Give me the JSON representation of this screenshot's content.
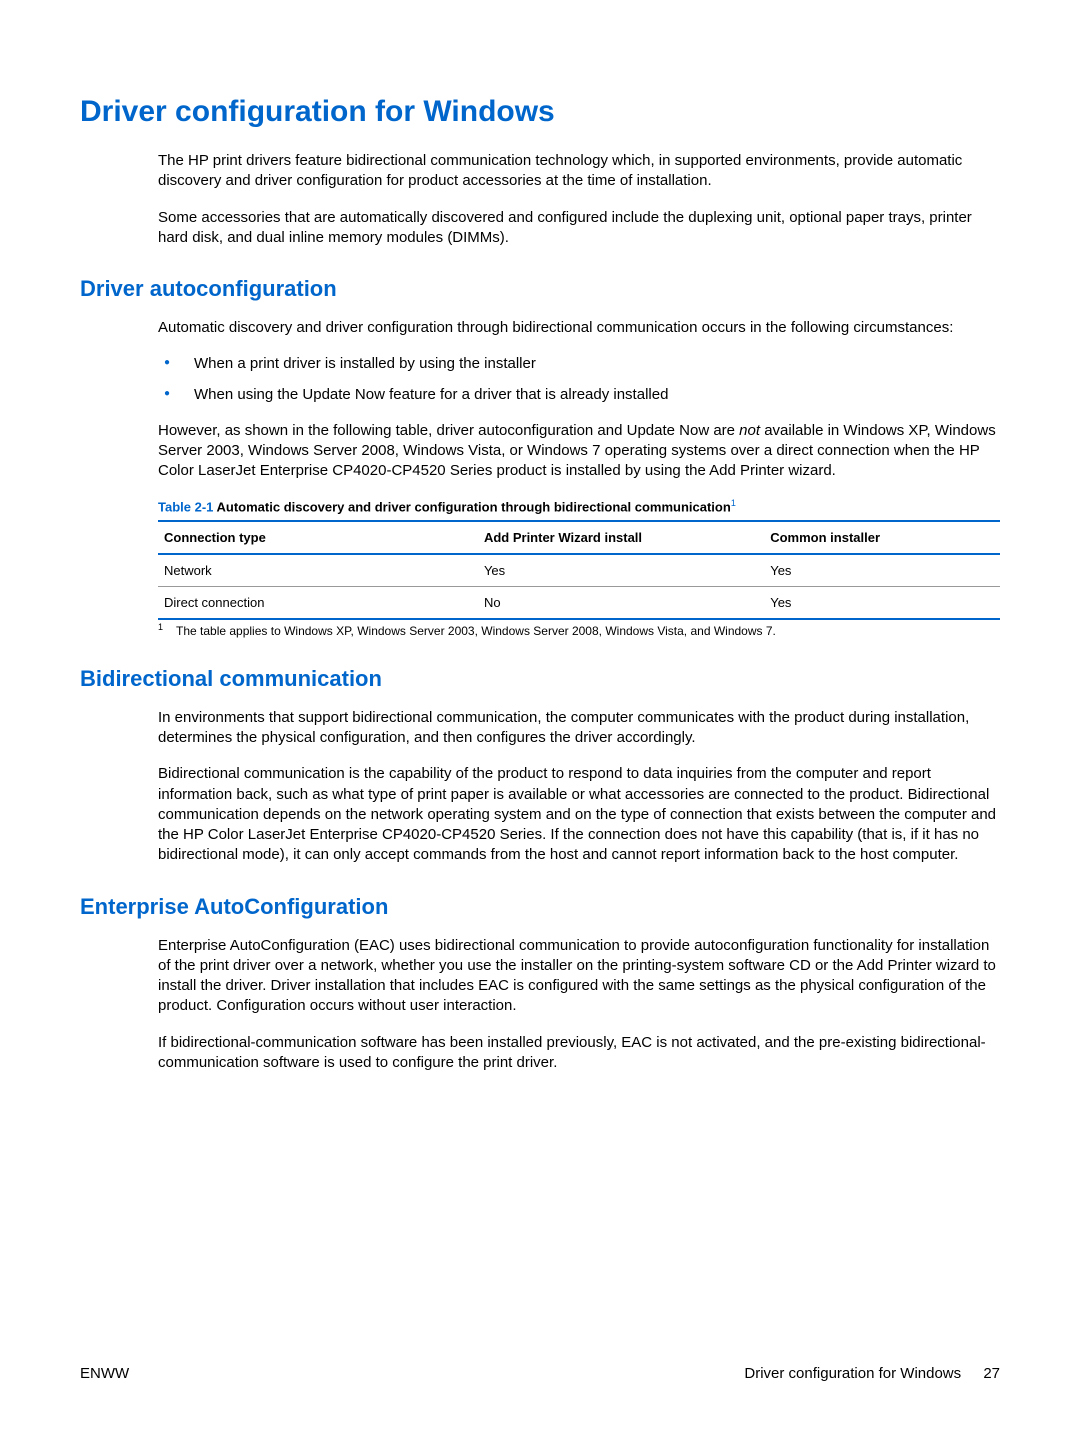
{
  "title": "Driver configuration for Windows",
  "intro": {
    "p1": "The HP print drivers feature bidirectional communication technology which, in supported environments, provide automatic discovery and driver configuration for product accessories at the time of installation.",
    "p2": "Some accessories that are automatically discovered and configured include the duplexing unit, optional paper trays, printer hard disk, and dual inline memory modules (DIMMs)."
  },
  "section_autoconfig": {
    "heading": "Driver autoconfiguration",
    "p1": "Automatic discovery and driver configuration through bidirectional communication occurs in the following circumstances:",
    "bullets": [
      "When a print driver is installed by using the installer",
      "When using the Update Now feature for a driver that is already installed"
    ],
    "p2_a": "However, as shown in the following table, driver autoconfiguration and Update Now are ",
    "p2_i": "not",
    "p2_b": " available in Windows XP, Windows Server 2003, Windows Server 2008, Windows Vista, or Windows 7 operating systems over a direct connection when the HP Color LaserJet Enterprise CP4020-CP4520 Series product is installed by using the Add Printer wizard.",
    "table": {
      "caption_label": "Table 2-1",
      "caption_title": "  Automatic discovery and driver configuration through bidirectional communication",
      "caption_sup": "1",
      "headers": [
        "Connection type",
        "Add Printer Wizard install",
        "Common installer"
      ],
      "rows": [
        [
          "Network",
          "Yes",
          "Yes"
        ],
        [
          "Direct connection",
          "No",
          "Yes"
        ]
      ]
    },
    "footnote_num": "1",
    "footnote_text": "The table applies to Windows XP, Windows Server 2003, Windows Server 2008, Windows Vista, and Windows 7."
  },
  "section_bidi": {
    "heading": "Bidirectional communication",
    "p1": "In environments that support bidirectional communication, the computer communicates with the product during installation, determines the physical configuration, and then configures the driver accordingly.",
    "p2": "Bidirectional communication is the capability of the product to respond to data inquiries from the computer and report information back, such as what type of print paper is available or what accessories are connected to the product. Bidirectional communication depends on the network operating system and on the type of connection that exists between the computer and the HP Color LaserJet Enterprise CP4020-CP4520 Series. If the connection does not have this capability (that is, if it has no bidirectional mode), it can only accept commands from the host and cannot report information back to the host computer."
  },
  "section_eac": {
    "heading": "Enterprise AutoConfiguration",
    "p1": "Enterprise AutoConfiguration (EAC) uses bidirectional communication to provide autoconfiguration functionality for installation of the print driver over a network, whether you use the installer on the printing-system software CD or the Add Printer wizard to install the driver. Driver installation that includes EAC is configured with the same settings as the physical configuration of the product. Configuration occurs without user interaction.",
    "p2": "If bidirectional-communication software has been installed previously, EAC is not activated, and the pre-existing bidirectional-communication software is used to configure the print driver."
  },
  "footer": {
    "left": "ENWW",
    "right_text": "Driver configuration for Windows",
    "page": "27"
  }
}
